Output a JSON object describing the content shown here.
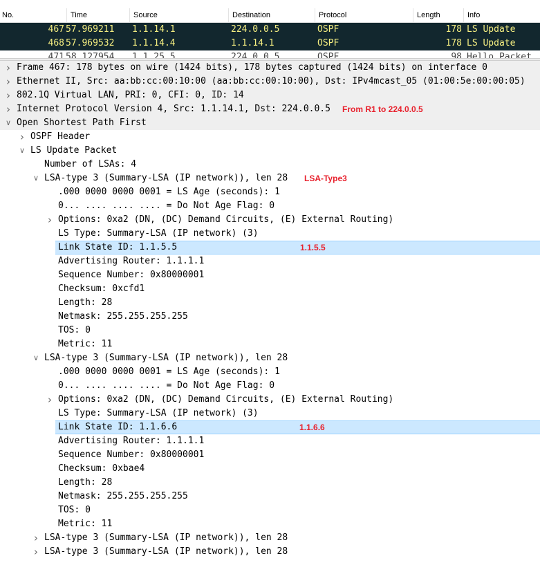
{
  "packet_list": {
    "columns": [
      "No.",
      "Time",
      "Source",
      "Destination",
      "Protocol",
      "Length",
      "Info"
    ],
    "rows": [
      {
        "no": "467",
        "time": "57.969211",
        "source": "1.1.14.1",
        "destination": "224.0.0.5",
        "protocol": "OSPF",
        "length": "178",
        "info": "LS Update"
      },
      {
        "no": "468",
        "time": "57.969532",
        "source": "1.1.14.4",
        "destination": "1.1.14.1",
        "protocol": "OSPF",
        "length": "178",
        "info": "LS Update"
      },
      {
        "no": "471",
        "time": "58.127954",
        "source": "1.1.25.5",
        "destination": "224.0.0.5",
        "protocol": "OSPF",
        "length": "98",
        "info": "Hello Packet"
      }
    ],
    "colors": {
      "selected_bg": "#12272e",
      "selected_fg": "#f7f082"
    }
  },
  "detail_tree": [
    {
      "text": "Frame 467: 178 bytes on wire (1424 bits), 178 bytes captured (1424 bits) on interface 0",
      "level": 0,
      "toggle": "collapsed"
    },
    {
      "text": "Ethernet II, Src: aa:bb:cc:00:10:00 (aa:bb:cc:00:10:00), Dst: IPv4mcast_05 (01:00:5e:00:00:05)",
      "level": 0,
      "toggle": "collapsed"
    },
    {
      "text": "802.1Q Virtual LAN, PRI: 0, CFI: 0, ID: 14",
      "level": 0,
      "toggle": "collapsed"
    },
    {
      "text": "Internet Protocol Version 4, Src: 1.1.14.1, Dst: 224.0.0.5",
      "level": 0,
      "toggle": "collapsed",
      "note": "From R1 to 224.0.0.5"
    },
    {
      "text": "Open Shortest Path First",
      "level": 0,
      "toggle": "expanded"
    },
    {
      "text": "OSPF Header",
      "level": 1,
      "toggle": "collapsed"
    },
    {
      "text": "LS Update Packet",
      "level": 1,
      "toggle": "expanded"
    },
    {
      "text": "Number of LSAs: 4",
      "level": 2,
      "toggle": "none"
    },
    {
      "text": "LSA-type 3 (Summary-LSA (IP network)), len 28",
      "level": 2,
      "toggle": "expanded",
      "note": "LSA-Type3"
    },
    {
      "text": ".000 0000 0000 0001 = LS Age (seconds): 1",
      "level": 3,
      "toggle": "none"
    },
    {
      "text": "0... .... .... .... = Do Not Age Flag: 0",
      "level": 3,
      "toggle": "none"
    },
    {
      "text": "Options: 0xa2 (DN, (DC) Demand Circuits, (E) External Routing)",
      "level": 3,
      "toggle": "collapsed"
    },
    {
      "text": "LS Type: Summary-LSA (IP network) (3)",
      "level": 3,
      "toggle": "none"
    },
    {
      "text": "Link State ID: 1.1.5.5",
      "level": 3,
      "toggle": "none",
      "selected": true,
      "note": "1.1.5.5"
    },
    {
      "text": "Advertising Router: 1.1.1.1",
      "level": 3,
      "toggle": "none"
    },
    {
      "text": "Sequence Number: 0x80000001",
      "level": 3,
      "toggle": "none"
    },
    {
      "text": "Checksum: 0xcfd1",
      "level": 3,
      "toggle": "none"
    },
    {
      "text": "Length: 28",
      "level": 3,
      "toggle": "none"
    },
    {
      "text": "Netmask: 255.255.255.255",
      "level": 3,
      "toggle": "none"
    },
    {
      "text": "TOS: 0",
      "level": 3,
      "toggle": "none"
    },
    {
      "text": "Metric: 11",
      "level": 3,
      "toggle": "none"
    },
    {
      "text": "LSA-type 3 (Summary-LSA (IP network)), len 28",
      "level": 2,
      "toggle": "expanded"
    },
    {
      "text": ".000 0000 0000 0001 = LS Age (seconds): 1",
      "level": 3,
      "toggle": "none"
    },
    {
      "text": "0... .... .... .... = Do Not Age Flag: 0",
      "level": 3,
      "toggle": "none"
    },
    {
      "text": "Options: 0xa2 (DN, (DC) Demand Circuits, (E) External Routing)",
      "level": 3,
      "toggle": "collapsed"
    },
    {
      "text": "LS Type: Summary-LSA (IP network) (3)",
      "level": 3,
      "toggle": "none"
    },
    {
      "text": "Link State ID: 1.1.6.6",
      "level": 3,
      "toggle": "none",
      "selected": true,
      "note": "1.1.6.6"
    },
    {
      "text": "Advertising Router: 1.1.1.1",
      "level": 3,
      "toggle": "none"
    },
    {
      "text": "Sequence Number: 0x80000001",
      "level": 3,
      "toggle": "none"
    },
    {
      "text": "Checksum: 0xbae4",
      "level": 3,
      "toggle": "none"
    },
    {
      "text": "Length: 28",
      "level": 3,
      "toggle": "none"
    },
    {
      "text": "Netmask: 255.255.255.255",
      "level": 3,
      "toggle": "none"
    },
    {
      "text": "TOS: 0",
      "level": 3,
      "toggle": "none"
    },
    {
      "text": "Metric: 11",
      "level": 3,
      "toggle": "none"
    },
    {
      "text": "LSA-type 3 (Summary-LSA (IP network)), len 28",
      "level": 2,
      "toggle": "collapsed"
    },
    {
      "text": "LSA-type 3 (Summary-LSA (IP network)), len 28",
      "level": 2,
      "toggle": "collapsed"
    }
  ],
  "annotation_color": "#e8212d",
  "icons": {
    "collapsed": "chevron-right-icon",
    "expanded": "chevron-down-icon"
  }
}
